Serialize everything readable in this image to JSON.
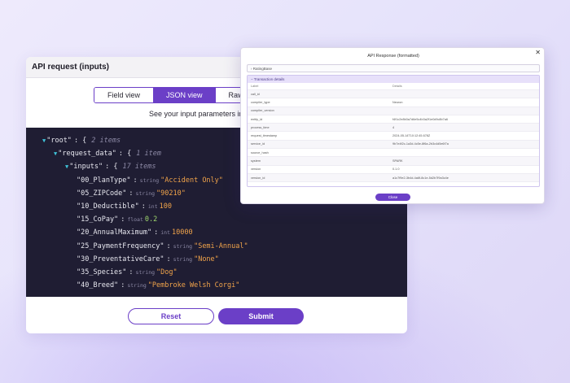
{
  "main": {
    "title": "API request (inputs)",
    "tabs": [
      {
        "label": "Field view",
        "active": false
      },
      {
        "label": "JSON view",
        "active": true
      },
      {
        "label": "Raw",
        "active": false
      }
    ],
    "helper": "See your input parameters in",
    "json_tree": {
      "root_key": "\"root\"",
      "root_count": "2 items",
      "request_key": "\"request_data\"",
      "request_count": "1 item",
      "inputs_key": "\"inputs\"",
      "inputs_count": "17 items",
      "entries": [
        {
          "key": "\"00_PlanType\"",
          "type": "string",
          "value": "\"Accident Only\"",
          "kind": "str"
        },
        {
          "key": "\"05_ZIPCode\"",
          "type": "string",
          "value": "\"90210\"",
          "kind": "str"
        },
        {
          "key": "\"10_Deductible\"",
          "type": "int",
          "value": "100",
          "kind": "num"
        },
        {
          "key": "\"15_CoPay\"",
          "type": "float",
          "value": "0.2",
          "kind": "float"
        },
        {
          "key": "\"20_AnnualMaximum\"",
          "type": "int",
          "value": "10000",
          "kind": "num"
        },
        {
          "key": "\"25_PaymentFrequency\"",
          "type": "string",
          "value": "\"Semi-Annual\"",
          "kind": "str"
        },
        {
          "key": "\"30_PreventativeCare\"",
          "type": "string",
          "value": "\"None\"",
          "kind": "str"
        },
        {
          "key": "\"35_Species\"",
          "type": "string",
          "value": "\"Dog\"",
          "kind": "str"
        },
        {
          "key": "\"40_Breed\"",
          "type": "string",
          "value": "\"Pembroke Welsh Corgi\"",
          "kind": "str"
        }
      ]
    },
    "reset_label": "Reset",
    "submit_label": "Submit"
  },
  "dialog": {
    "title": "API Response (formatted)",
    "close_glyph": "✕",
    "collapsed_label": "› RatingBase",
    "section_label": "− Transaction details",
    "columns": [
      "Label",
      "Details"
    ],
    "rows": [
      [
        "call_id",
        ""
      ],
      [
        "compiler_type",
        "Neuron"
      ],
      [
        "compiler_version",
        ""
      ],
      [
        "entity_id",
        "f4f1c2e8b3a7d6e5c4b3a2f1e0d9c8b7a6"
      ],
      [
        "process_time",
        "4"
      ],
      [
        "request_timestamp",
        "2024-05-14T10:12:45.678Z"
      ],
      [
        "service_id",
        "9b7e4f2c-1a3d-4c5e-8f6a-2b3c4d5e6f7a"
      ],
      [
        "source_hash",
        ""
      ],
      [
        "system",
        "SPARK"
      ],
      [
        "version",
        "0.1.0"
      ],
      [
        "version_id",
        "a1c7f9e2-3b4d-4a6f-8c1e-5d2b7f9a3c4e"
      ]
    ],
    "close_label": "Close"
  }
}
